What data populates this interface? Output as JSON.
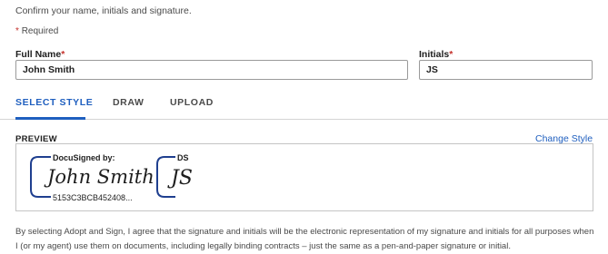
{
  "instructions": "Confirm your name, initials and signature.",
  "required_note": {
    "star": "*",
    "text": "Required"
  },
  "full_name": {
    "label": "Full Name",
    "star": "*",
    "value": "John Smith"
  },
  "initials": {
    "label": "Initials",
    "star": "*",
    "value": "JS"
  },
  "tabs": [
    {
      "label": "SELECT STYLE",
      "active": true
    },
    {
      "label": "DRAW",
      "active": false
    },
    {
      "label": "UPLOAD",
      "active": false
    }
  ],
  "preview": {
    "label": "PREVIEW",
    "change_style": "Change Style",
    "signature": {
      "header": "DocuSigned by:",
      "script_text": "John Smith",
      "id": "5153C3BCB452408..."
    },
    "initials": {
      "header": "DS",
      "script_text": "JS"
    }
  },
  "disclaimer": "By selecting Adopt and Sign, I agree that the signature and initials will be the electronic representation of my signature and initials for all purposes when I (or my agent) use them on documents, including legally binding contracts – just the same as a pen-and-paper signature or initial.",
  "colors": {
    "accent": "#1f5fbf",
    "required_star": "#c4302b",
    "signature_bracket": "#1f3f8f"
  }
}
